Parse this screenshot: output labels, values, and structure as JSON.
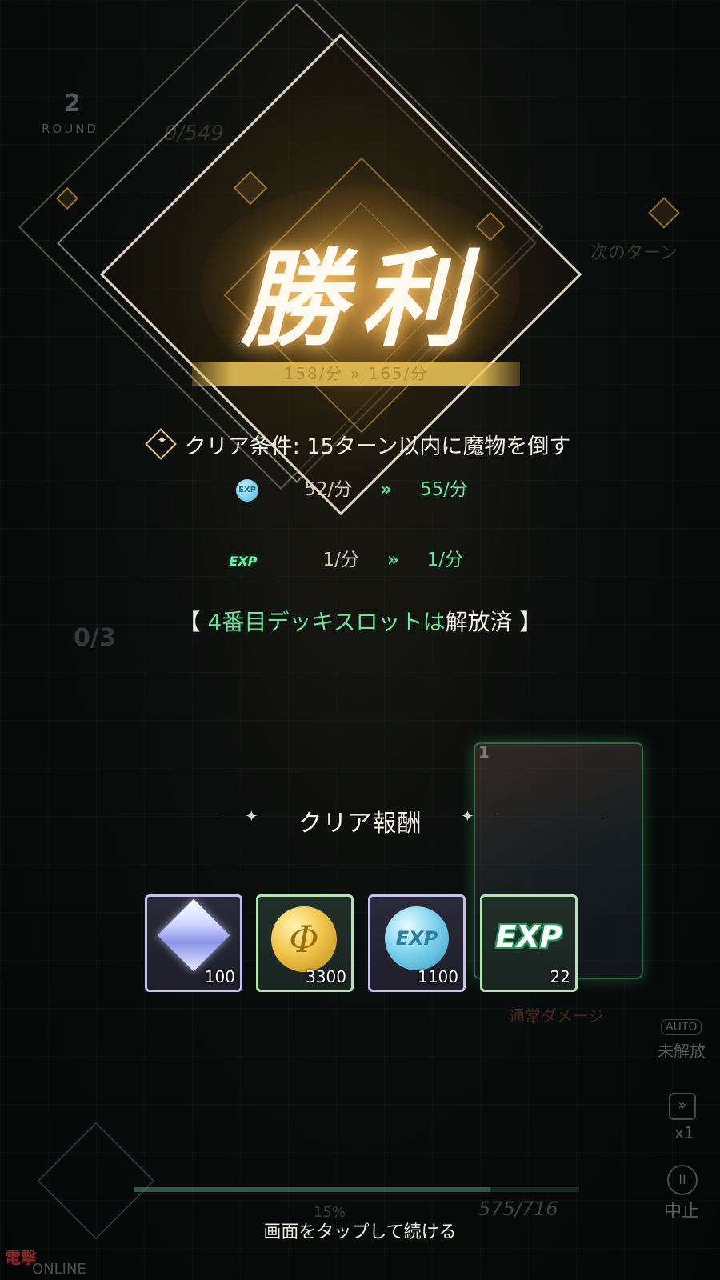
{
  "hud": {
    "round_number": "2",
    "round_label": "ROUND",
    "enemy_hp": "0/549",
    "next_turn": "次のターン",
    "counter": "0/3",
    "normal_damage": "通常ダメージ",
    "auto_badge": "AUTO",
    "auto_status": "未解放",
    "speed": "x1",
    "pause": "中止",
    "player_hp": "575/716",
    "hp_percent": "15%",
    "hp_fraction": 0.8,
    "card_number": "1"
  },
  "victory": {
    "title": "勝利",
    "ribbon_text": "158/分  »  165/分"
  },
  "clear_condition": "クリア条件: 15ターン以内に魔物を倒す",
  "rates": [
    {
      "icon": "exp-coin-icon",
      "icon_text": "EXP",
      "old": "52/分",
      "arrow": "»",
      "new": "55/分"
    },
    {
      "icon": "exp-text-icon",
      "icon_text": "EXP",
      "old": "1/分",
      "arrow": "»",
      "new": "1/分"
    }
  ],
  "unlock": {
    "open_bracket": "【",
    "highlight": "4番目デッキスロットは",
    "rest": "解放済",
    "close_bracket": "】"
  },
  "rewards": {
    "title": "クリア報酬",
    "items": [
      {
        "icon": "crystal-gem-icon",
        "quantity": "100"
      },
      {
        "icon": "gold-coin-icon",
        "symbol": "Φ",
        "quantity": "3300"
      },
      {
        "icon": "exp-coin-icon",
        "symbol": "EXP",
        "quantity": "1100"
      },
      {
        "icon": "exp-icon",
        "symbol": "EXP",
        "quantity": "22"
      }
    ]
  },
  "tap_to_continue": "画面をタップして続ける",
  "watermark": {
    "brand": "電撃",
    "sub": "ONLINE"
  },
  "colors": {
    "gold": "#e7c98a",
    "green": "#67e39b",
    "accent_border_purple": "#c7bff0",
    "accent_border_green": "#b6e3b4"
  }
}
